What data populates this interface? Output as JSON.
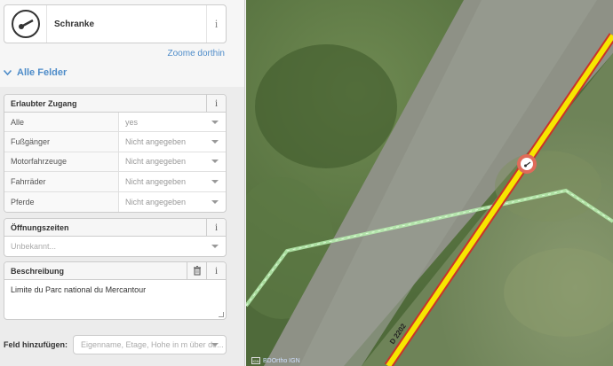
{
  "preset": {
    "name": "Schranke",
    "icon": "barrier-icon",
    "info_glyph": "i"
  },
  "zoom_link": "Zoome dorthin",
  "section": {
    "title": "Alle Felder",
    "chevron": "chevron-down-icon"
  },
  "fields": {
    "access": {
      "label": "Erlaubter Zugang",
      "rows": [
        {
          "key": "Alle",
          "value": "yes"
        },
        {
          "key": "Fußgänger",
          "value": "Nicht angegeben"
        },
        {
          "key": "Motorfahrzeuge",
          "value": "Nicht angegeben"
        },
        {
          "key": "Fahrräder",
          "value": "Nicht angegeben"
        },
        {
          "key": "Pferde",
          "value": "Nicht angegeben"
        }
      ]
    },
    "opening_hours": {
      "label": "Öffnungszeiten",
      "placeholder": "Unbekannt..."
    },
    "description": {
      "label": "Beschreibung",
      "value": "Limite du Parc national du Mercantour"
    }
  },
  "add_field": {
    "label": "Feld hinzufügen:",
    "placeholder": "Eigenname, Etage, Hohe in m über de..."
  },
  "map": {
    "attribution": "BDOrtho IGN",
    "ign_logo": "IGN",
    "road_ref": "D 2202",
    "colors": {
      "road_fill": "#f7e600",
      "road_casing": "#c8332b",
      "boundary": "#b8f0b0",
      "vertex": "#e06b5a"
    }
  }
}
